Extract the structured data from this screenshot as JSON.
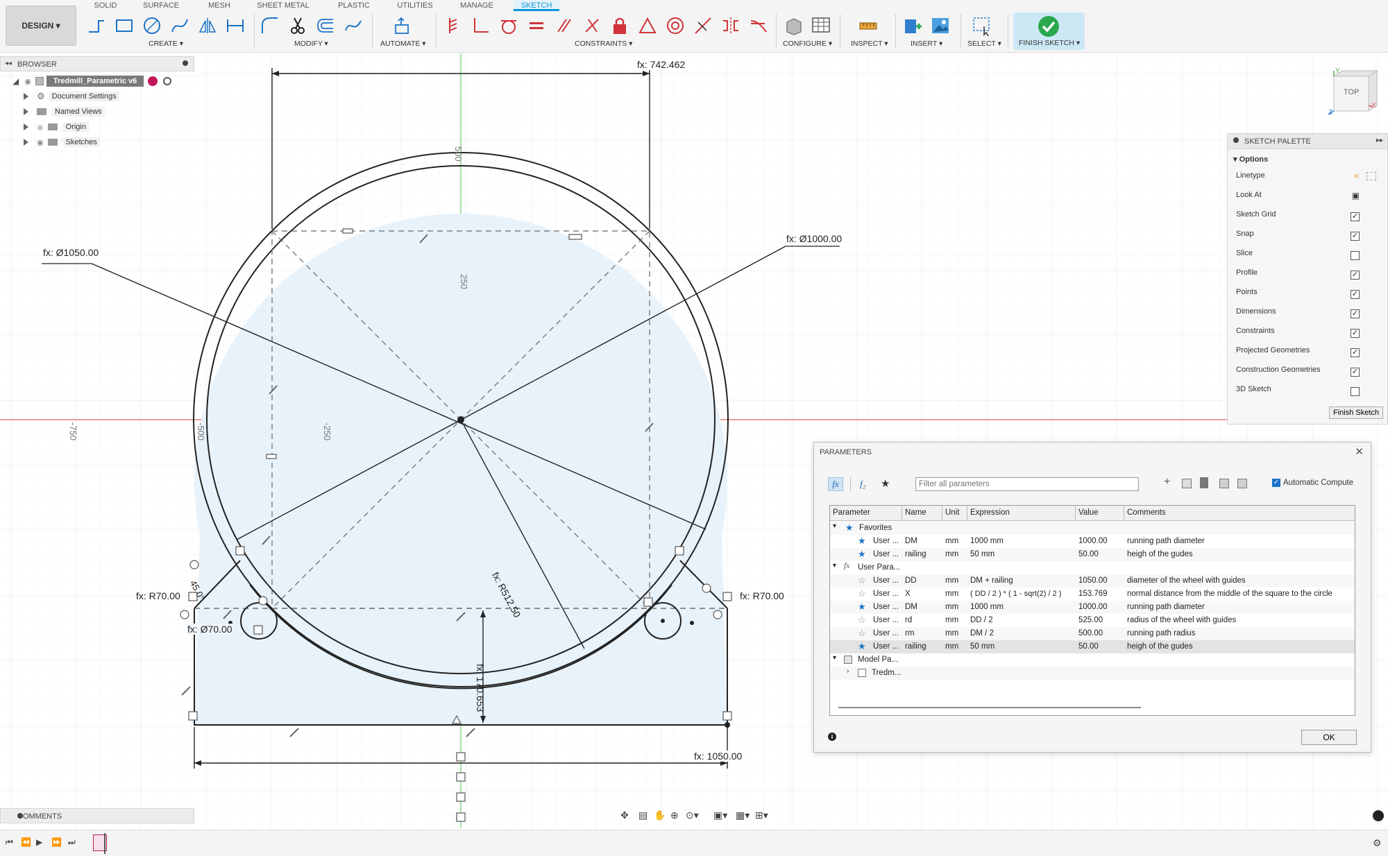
{
  "toolbar": {
    "design_label": "DESIGN ▾",
    "tabs": [
      "SOLID",
      "SURFACE",
      "MESH",
      "SHEET METAL",
      "PLASTIC",
      "UTILITIES",
      "MANAGE",
      "SKETCH"
    ],
    "active_tab": "SKETCH",
    "groups": [
      "CREATE ▾",
      "MODIFY ▾",
      "AUTOMATE ▾",
      "CONSTRAINTS ▾",
      "CONFIGURE ▾",
      "INSPECT ▾",
      "INSERT ▾",
      "SELECT ▾",
      "FINISH SKETCH ▾"
    ]
  },
  "browser": {
    "title": "BROWSER",
    "root": "Tredmill_Parametric v6",
    "items": [
      "Document Settings",
      "Named Views",
      "Origin",
      "Sketches"
    ]
  },
  "viewcube": {
    "face": "TOP",
    "axis_x": "X",
    "axis_y": "Y",
    "axis_z": "Z"
  },
  "sketch": {
    "dimensions": {
      "top_width": "fx: 742.462",
      "dia_outer": "fx: Ø1050.00",
      "dia_inner": "fx: Ø1000.00",
      "radius": "fx: R512.50",
      "fillet_left": "fx: R70.00",
      "fillet_right": "fx: R70.00",
      "small_dia": "fx: Ø70.00",
      "angle": "45.0°",
      "bottom_width": "fx: 1050.00",
      "height": "fx: 170.653"
    },
    "grid_labels": [
      "500",
      "250",
      "-250",
      "-500",
      "-750"
    ]
  },
  "palette": {
    "title": "SKETCH PALETTE",
    "section": "Options",
    "options": [
      {
        "label": "Linetype",
        "type": "icon"
      },
      {
        "label": "Look At",
        "type": "icon"
      },
      {
        "label": "Sketch Grid",
        "checked": true
      },
      {
        "label": "Snap",
        "checked": true
      },
      {
        "label": "Slice",
        "checked": false
      },
      {
        "label": "Profile",
        "checked": true
      },
      {
        "label": "Points",
        "checked": true
      },
      {
        "label": "Dimensions",
        "checked": true
      },
      {
        "label": "Constraints",
        "checked": true
      },
      {
        "label": "Projected Geometries",
        "checked": true
      },
      {
        "label": "Construction Geometries",
        "checked": true
      },
      {
        "label": "3D Sketch",
        "checked": false
      }
    ],
    "finish_label": "Finish Sketch"
  },
  "params": {
    "title": "PARAMETERS",
    "filter_placeholder": "Filter all parameters",
    "auto_compute": "Automatic Compute",
    "columns": [
      "Parameter",
      "Name",
      "Unit",
      "Expression",
      "Value",
      "Comments"
    ],
    "favorites_label": "Favorites",
    "user_label": "User Para...",
    "model_label": "Model Pa...",
    "model_child": "Tredm...",
    "favorites": [
      {
        "param": "User ...",
        "name": "DM",
        "unit": "mm",
        "expr": "1000 mm",
        "value": "1000.00",
        "comment": "running path diameter",
        "fav": true
      },
      {
        "param": "User ...",
        "name": "railing",
        "unit": "mm",
        "expr": "50 mm",
        "value": "50.00",
        "comment": "heigh of the gudes",
        "fav": true
      }
    ],
    "user": [
      {
        "param": "User ...",
        "name": "DD",
        "unit": "mm",
        "expr": "DM + railing",
        "value": "1050.00",
        "comment": "diameter of the wheel with guides",
        "fav": false
      },
      {
        "param": "User ...",
        "name": "X",
        "unit": "mm",
        "expr": "( DD / 2 ) * ( 1 - sqrt(2) / 2 )",
        "value": "153.769",
        "comment": "normal distance from the middle of the square to the circle",
        "fav": false
      },
      {
        "param": "User ...",
        "name": "DM",
        "unit": "mm",
        "expr": "1000 mm",
        "value": "1000.00",
        "comment": "running path diameter",
        "fav": true
      },
      {
        "param": "User ...",
        "name": "rd",
        "unit": "mm",
        "expr": "DD / 2",
        "value": "525.00",
        "comment": "radius of the wheel with guides",
        "fav": false
      },
      {
        "param": "User ...",
        "name": "rm",
        "unit": "mm",
        "expr": "DM / 2",
        "value": "500.00",
        "comment": "running path radius",
        "fav": false
      },
      {
        "param": "User ...",
        "name": "railing",
        "unit": "mm",
        "expr": "50 mm",
        "value": "50.00",
        "comment": "heigh of the gudes",
        "fav": true
      }
    ],
    "ok_label": "OK"
  },
  "comments_label": "COMMENTS"
}
